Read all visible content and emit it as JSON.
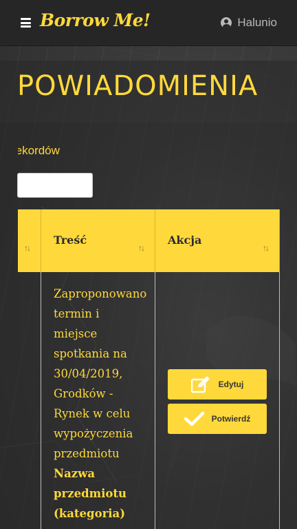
{
  "navbar": {
    "brand": "Borrow Me!",
    "username": "Halunio",
    "icons": {
      "menu": "hamburger-icon",
      "user": "user-circle-icon"
    }
  },
  "page": {
    "title": "POWIADOMIENIA",
    "records_label": "rekordów"
  },
  "table": {
    "columns": [
      {
        "label": ""
      },
      {
        "label": "Treść"
      },
      {
        "label": "Akcja"
      }
    ],
    "sort_icon": "↑↓",
    "rows": [
      {
        "message_lines": [
          "Zaproponowano",
          "termin i",
          "miejsce",
          "spotkania na",
          "30/04/2019,",
          "Grodków -",
          "Rynek w celu",
          "wypożyczenia",
          "przedmiotu"
        ],
        "item_lines": [
          "Nazwa",
          "przedmiotu",
          "(kategoria)"
        ],
        "actions": {
          "edit": "Edytuj",
          "confirm": "Potwierdź"
        }
      }
    ]
  },
  "colors": {
    "accent": "#ffd93b",
    "navbar": "#262626"
  }
}
